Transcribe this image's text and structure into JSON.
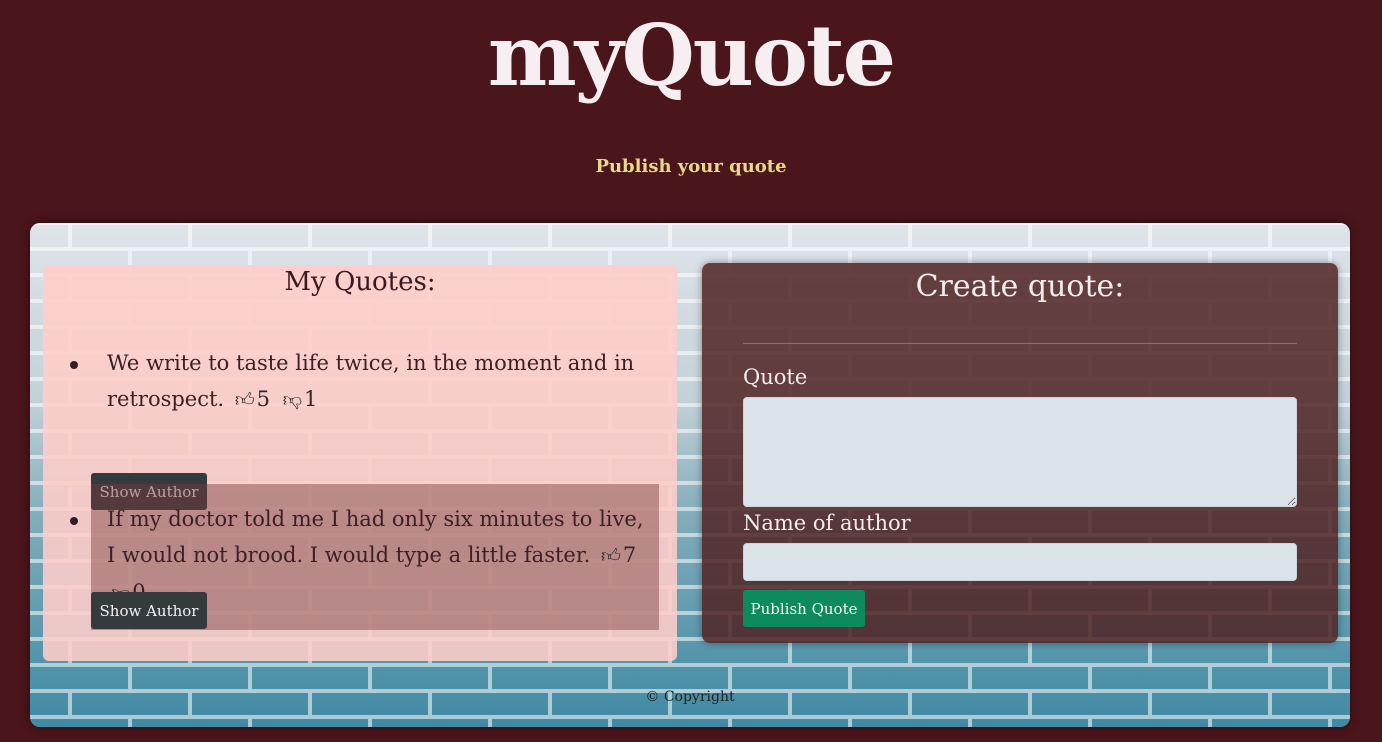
{
  "header": {
    "logo": "myQuote",
    "tagline": "Publish your quote"
  },
  "quotes_panel": {
    "title": "My Quotes:",
    "items": [
      {
        "text": "We write to taste life twice, in the moment and in retrospect.",
        "likes": "5",
        "dislikes": "1",
        "button_label": "Show Author"
      },
      {
        "text": "If my doctor told me I had only six minutes to live, I would not brood. I would type a little faster.",
        "likes": "7",
        "dislikes": "0",
        "button_label": "Show Author"
      }
    ]
  },
  "create_panel": {
    "title": "Create quote:",
    "quote_label": "Quote",
    "quote_value": "",
    "author_label": "Name of author",
    "author_value": "",
    "submit_label": "Publish Quote"
  },
  "footer": {
    "text": "© Copyright"
  },
  "icons": {
    "like": "thumbs-up-icon",
    "dislike": "thumbs-down-icon"
  },
  "colors": {
    "page_background": "#4a151b",
    "logo": "#f6eef0",
    "tagline": "#e9d88a",
    "quotes_panel": "#ffcdc8",
    "create_panel": "#502424",
    "dark_button": "#353a3f",
    "publish_button": "#0e8a5f"
  }
}
